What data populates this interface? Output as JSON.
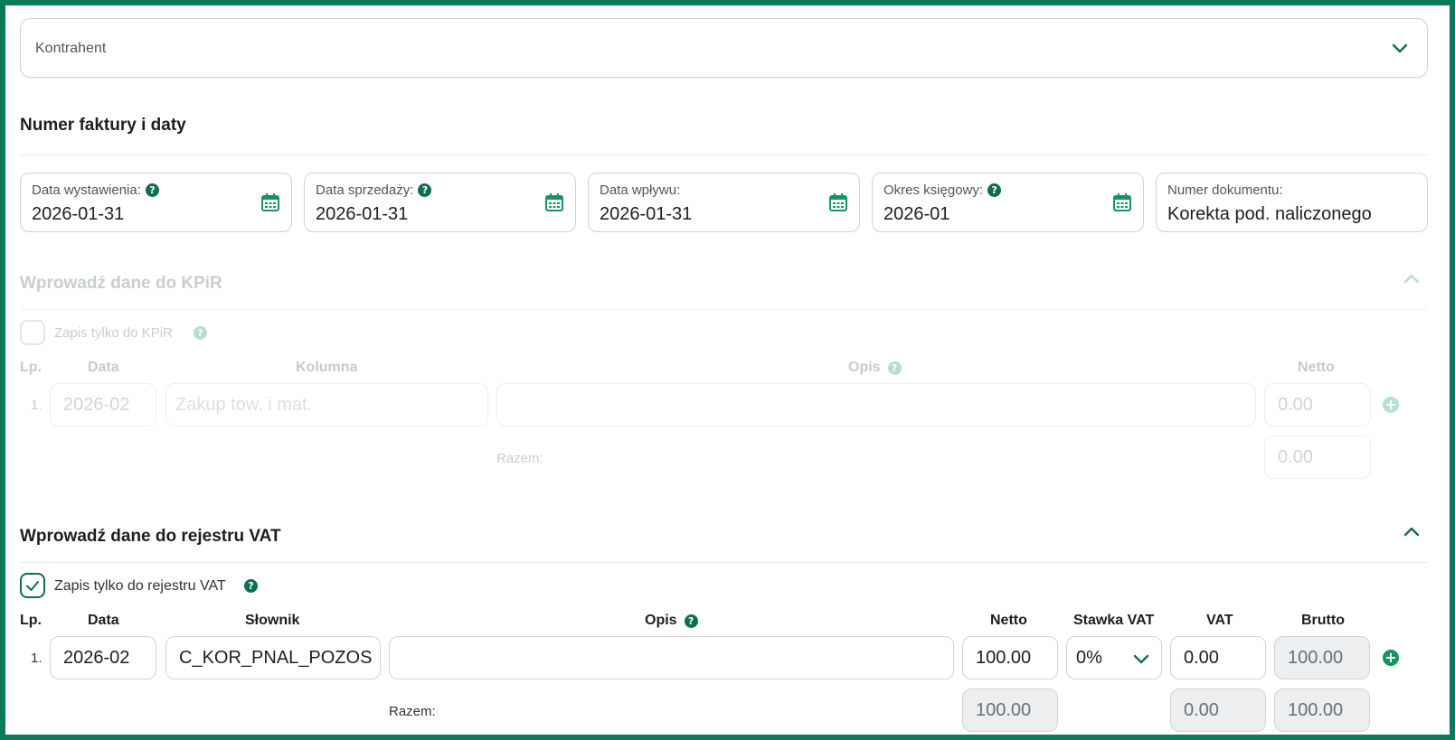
{
  "kontrahent": {
    "label": "Kontrahent"
  },
  "invoice_section": {
    "title": "Numer faktury i daty",
    "fields": [
      {
        "label": "Data wystawienia:",
        "value": "2026-01-31",
        "help": "?"
      },
      {
        "label": "Data sprzedaży:",
        "value": "2026-01-31",
        "help": "?"
      },
      {
        "label": "Data wpływu:",
        "value": "2026-01-31"
      },
      {
        "label": "Okres księgowy:",
        "value": "2026-01",
        "help": "?"
      },
      {
        "label": "Numer dokumentu:",
        "value": "Korekta pod. naliczonego"
      }
    ]
  },
  "kpir_section": {
    "title": "Wprowadź dane do KPiR",
    "checkbox_label": "Zapis tylko do KPiR",
    "columns": {
      "lp": "Lp.",
      "data": "Data",
      "kolumna": "Kolumna",
      "opis": "Opis",
      "netto": "Netto"
    },
    "row": {
      "lp": "1.",
      "data": "2026-02",
      "kolumna_placeholder": "Zakup tow. i mat.",
      "opis": "",
      "netto": "0.00"
    },
    "razem_label": "Razem:",
    "razem_netto": "0.00"
  },
  "vat_section": {
    "title": "Wprowadź dane do rejestru VAT",
    "checkbox_label": "Zapis tylko do rejestru VAT",
    "checkbox_checked": true,
    "columns": {
      "lp": "Lp.",
      "data": "Data",
      "slownik": "Słownik",
      "opis": "Opis",
      "netto": "Netto",
      "stawka": "Stawka VAT",
      "vat": "VAT",
      "brutto": "Brutto"
    },
    "row": {
      "lp": "1.",
      "data": "2026-02",
      "slownik": "C_KOR_PNAL_POZOS",
      "opis": "",
      "netto": "100.00",
      "stawka": "0%",
      "vat": "0.00",
      "brutto": "100.00"
    },
    "razem_label": "Razem:",
    "razem": {
      "netto": "100.00",
      "vat": "0.00",
      "brutto": "100.00"
    }
  },
  "icons": {
    "help": "?",
    "plus": "+"
  },
  "colors": {
    "accent": "#0e6e55",
    "frame": "#0b7a5a",
    "calendar": "#17955f"
  }
}
